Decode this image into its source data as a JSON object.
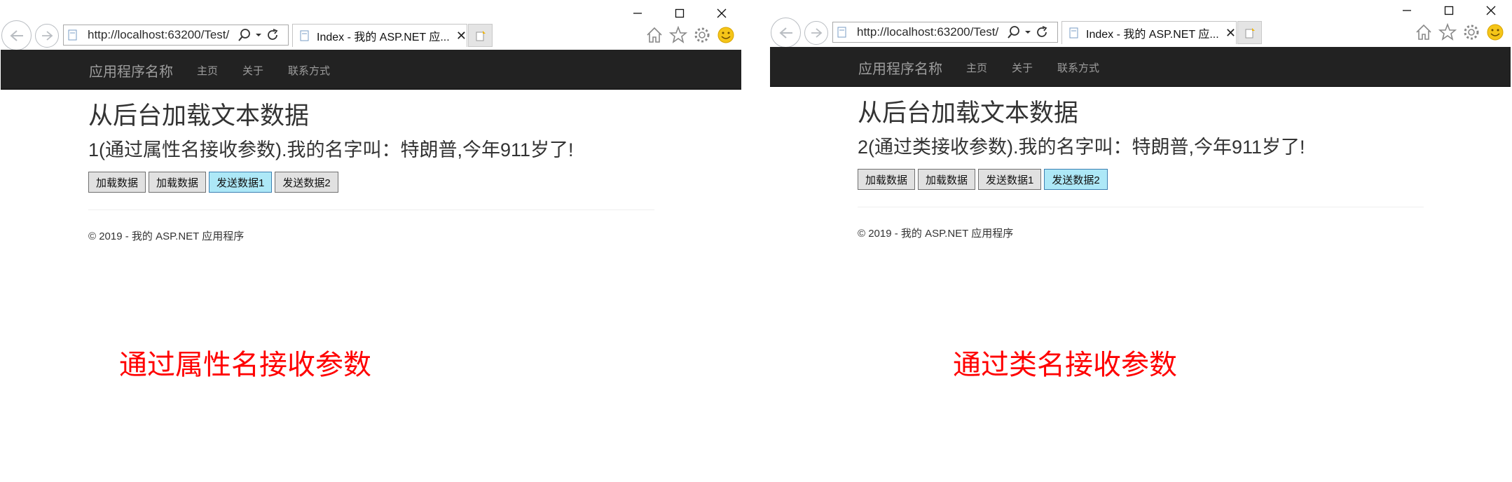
{
  "windows": [
    {
      "id": "left",
      "address": "http://localhost:63200/Test/",
      "tab_title": "Index - 我的 ASP.NET 应...",
      "tab_close": "✕",
      "navbar": {
        "brand": "应用程序名称",
        "links": [
          "主页",
          "关于",
          "联系方式"
        ]
      },
      "heading": "从后台加载文本数据",
      "message": "1(通过属性名接收参数).我的名字叫：特朗普,今年911岁了!",
      "buttons": [
        "加载数据",
        "加载数据",
        "发送数据1",
        "发送数据2"
      ],
      "active_button_index": 2,
      "footer": "© 2019 - 我的 ASP.NET 应用程序"
    },
    {
      "id": "right",
      "address": "http://localhost:63200/Test/",
      "tab_title": "Index - 我的 ASP.NET 应...",
      "tab_close": "✕",
      "navbar": {
        "brand": "应用程序名称",
        "links": [
          "主页",
          "关于",
          "联系方式"
        ]
      },
      "heading": "从后台加载文本数据",
      "message": "2(通过类接收参数).我的名字叫：特朗普,今年911岁了!",
      "buttons": [
        "加载数据",
        "加载数据",
        "发送数据1",
        "发送数据2"
      ],
      "active_button_index": 3,
      "footer": "© 2019 - 我的 ASP.NET 应用程序"
    }
  ],
  "captions": {
    "left": "通过属性名接收参数",
    "right": "通过类名接收参数"
  },
  "colors": {
    "navbar_bg": "#222222",
    "active_button_bg": "#ade8f7",
    "caption": "#ff0000"
  },
  "icons": [
    "back-arrow-icon",
    "forward-arrow-icon",
    "search-icon",
    "dropdown-icon",
    "refresh-icon",
    "page-icon",
    "new-tab-icon",
    "home-icon",
    "favorites-star-icon",
    "settings-gear-icon",
    "smiley-feedback-icon",
    "minimize-icon",
    "maximize-icon",
    "close-icon"
  ]
}
